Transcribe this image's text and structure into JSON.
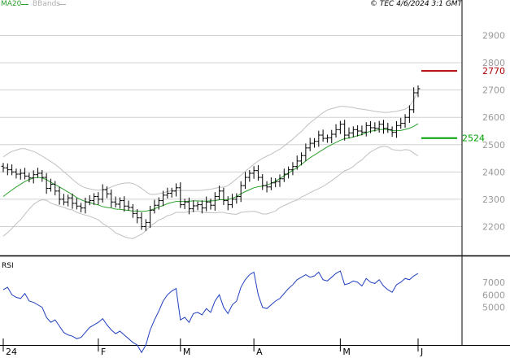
{
  "legend": {
    "ma_label": "MA20",
    "bb_label": "BBands",
    "ma_color": "#2ca02c",
    "bb_color": "#c0c0c0"
  },
  "copyright": "© TEC 4/6/2024 3:1 GMT",
  "rsi_label": "RSI",
  "chart_data": [
    {
      "type": "ohlc",
      "ylim": [
        2100,
        3000
      ],
      "yticks": [
        2200,
        2300,
        2400,
        2500,
        2600,
        2700,
        2800,
        2900
      ],
      "xtick_labels": [
        "24",
        "F",
        "M",
        "A",
        "M",
        "J"
      ],
      "xtick_index": [
        0,
        22,
        41,
        58,
        78,
        96
      ],
      "bar_color": "#000000",
      "close": [
        2415,
        2408,
        2400,
        2392,
        2395,
        2385,
        2378,
        2390,
        2395,
        2380,
        2340,
        2355,
        2330,
        2300,
        2290,
        2305,
        2285,
        2275,
        2268,
        2290,
        2295,
        2310,
        2300,
        2335,
        2320,
        2290,
        2282,
        2295,
        2275,
        2270,
        2248,
        2232,
        2200,
        2215,
        2260,
        2278,
        2295,
        2315,
        2322,
        2330,
        2342,
        2280,
        2290,
        2265,
        2276,
        2280,
        2268,
        2290,
        2278,
        2310,
        2330,
        2295,
        2280,
        2300,
        2310,
        2350,
        2380,
        2395,
        2405,
        2380,
        2350,
        2345,
        2360,
        2365,
        2375,
        2392,
        2408,
        2420,
        2440,
        2460,
        2488,
        2505,
        2512,
        2535,
        2523,
        2525,
        2538,
        2555,
        2575,
        2535,
        2543,
        2555,
        2550,
        2546,
        2570,
        2562,
        2560,
        2575,
        2560,
        2555,
        2545,
        2570,
        2578,
        2600,
        2628,
        2690,
        2705
      ],
      "rsi": [
        64,
        66,
        60,
        58,
        57,
        61,
        55,
        54,
        52,
        50,
        42,
        38,
        40,
        35,
        30,
        28,
        27,
        25,
        26,
        30,
        34,
        36,
        38,
        41,
        36,
        32,
        29,
        31,
        28,
        25,
        22,
        20,
        14,
        20,
        32,
        40,
        47,
        55,
        60,
        63,
        65,
        40,
        42,
        38,
        45,
        46,
        44,
        49,
        46,
        55,
        60,
        50,
        45,
        52,
        55,
        66,
        72,
        76,
        78,
        60,
        50,
        49,
        52,
        55,
        57,
        61,
        65,
        68,
        72,
        74,
        76,
        74,
        75,
        78,
        72,
        71,
        74,
        77,
        79,
        68,
        69,
        71,
        70,
        67,
        73,
        70,
        69,
        72,
        67,
        64,
        62,
        68,
        70,
        73,
        72,
        75,
        77
      ],
      "ma20": [
        2310,
        2322,
        2334,
        2345,
        2355,
        2365,
        2372,
        2378,
        2380,
        2378,
        2372,
        2362,
        2354,
        2345,
        2336,
        2326,
        2317,
        2306,
        2298,
        2292,
        2288,
        2283,
        2279,
        2273,
        2270,
        2268,
        2264,
        2263,
        2261,
        2259,
        2257,
        2257,
        2256,
        2256,
        2260,
        2265,
        2272,
        2277,
        2284,
        2288,
        2292,
        2292,
        2292,
        2293,
        2294,
        2294,
        2293,
        2293,
        2294,
        2295,
        2298,
        2298,
        2299,
        2304,
        2310,
        2320,
        2328,
        2335,
        2342,
        2346,
        2348,
        2352,
        2358,
        2366,
        2376,
        2386,
        2396,
        2406,
        2416,
        2428,
        2440,
        2452,
        2462,
        2472,
        2482,
        2492,
        2500,
        2508,
        2516,
        2522,
        2524,
        2528,
        2533,
        2537,
        2544,
        2549,
        2552,
        2555,
        2556,
        2555,
        2551,
        2551,
        2552,
        2556,
        2560,
        2567,
        2577
      ],
      "bb_upper": [
        2455,
        2466,
        2475,
        2480,
        2485,
        2485,
        2480,
        2475,
        2468,
        2458,
        2448,
        2438,
        2428,
        2415,
        2401,
        2388,
        2373,
        2360,
        2349,
        2342,
        2338,
        2335,
        2333,
        2335,
        2338,
        2345,
        2351,
        2356,
        2359,
        2360,
        2358,
        2350,
        2340,
        2328,
        2318,
        2318,
        2320,
        2324,
        2328,
        2332,
        2332,
        2332,
        2332,
        2332,
        2332,
        2332,
        2333,
        2335,
        2337,
        2340,
        2344,
        2344,
        2350,
        2362,
        2375,
        2388,
        2402,
        2415,
        2428,
        2440,
        2450,
        2458,
        2465,
        2475,
        2483,
        2495,
        2508,
        2520,
        2535,
        2548,
        2565,
        2580,
        2592,
        2605,
        2617,
        2627,
        2632,
        2636,
        2640,
        2640,
        2638,
        2636,
        2632,
        2630,
        2628,
        2625,
        2622,
        2620,
        2618,
        2618,
        2620,
        2622,
        2626,
        2630,
        2640,
        2665,
        2695
      ],
      "bb_lower": [
        2165,
        2178,
        2193,
        2210,
        2225,
        2245,
        2264,
        2281,
        2292,
        2298,
        2296,
        2286,
        2280,
        2275,
        2271,
        2264,
        2261,
        2252,
        2247,
        2242,
        2238,
        2231,
        2225,
        2211,
        2202,
        2191,
        2177,
        2170,
        2163,
        2158,
        2156,
        2164,
        2172,
        2184,
        2202,
        2212,
        2224,
        2230,
        2240,
        2244,
        2252,
        2252,
        2252,
        2254,
        2256,
        2256,
        2253,
        2251,
        2251,
        2250,
        2252,
        2252,
        2248,
        2246,
        2245,
        2252,
        2254,
        2255,
        2256,
        2252,
        2246,
        2246,
        2251,
        2257,
        2269,
        2277,
        2284,
        2292,
        2297,
        2308,
        2315,
        2324,
        2332,
        2339,
        2347,
        2357,
        2368,
        2380,
        2392,
        2404,
        2410,
        2420,
        2434,
        2444,
        2460,
        2473,
        2482,
        2490,
        2494,
        2492,
        2482,
        2480,
        2478,
        2482,
        2480,
        2469,
        2459
      ]
    },
    {
      "type": "line",
      "title": "RSI",
      "ylim": [
        20,
        90
      ],
      "line_color": "#1f3fbf"
    }
  ],
  "markers": [
    {
      "label": "2770",
      "value": 2770,
      "color": "#b00000"
    },
    {
      "label": "2524",
      "value": 2524,
      "color": "#00a000"
    }
  ],
  "rsi_axis_labels": [
    "7000",
    "6000",
    "5000"
  ]
}
